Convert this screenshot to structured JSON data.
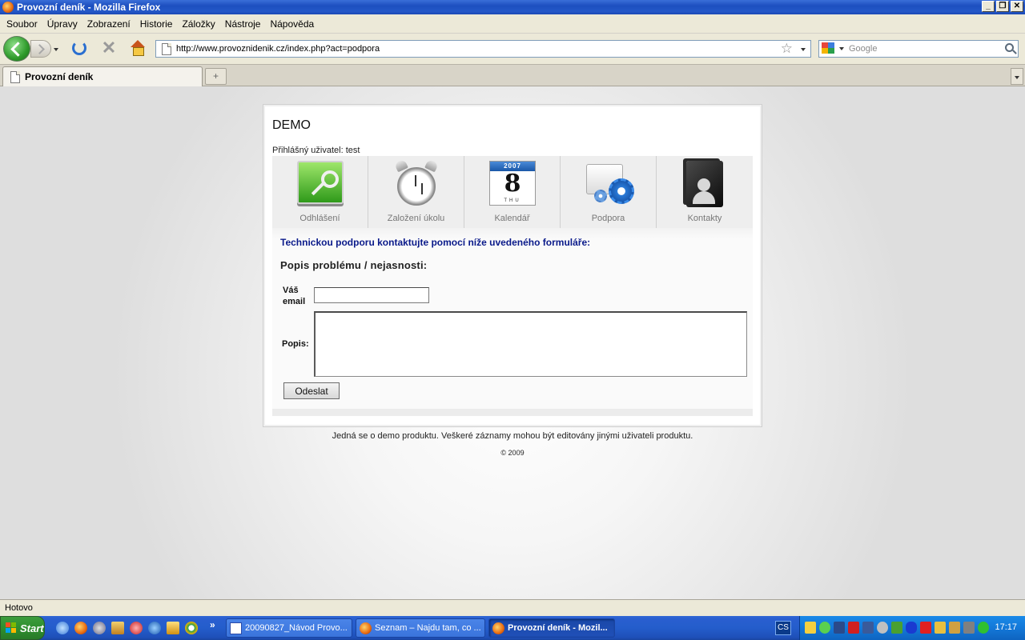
{
  "window": {
    "title": "Provozní deník - Mozilla Firefox",
    "buttons": {
      "minimize": "_",
      "maximize": "❐",
      "close": "✕"
    }
  },
  "menu": [
    "Soubor",
    "Úpravy",
    "Zobrazení",
    "Historie",
    "Záložky",
    "Nástroje",
    "Nápověda"
  ],
  "toolbar": {
    "url": "http://www.provoznidenik.cz/index.php?act=podpora",
    "search_placeholder": "Google"
  },
  "tabs": [
    {
      "label": "Provozní deník"
    }
  ],
  "page": {
    "site_title": "DEMO",
    "logged_user": "Přihlášný uživatel: test",
    "nav": [
      {
        "label": "Odhlášení",
        "icon": "key-icon"
      },
      {
        "label": "Založení úkolu",
        "icon": "alarm-clock-icon"
      },
      {
        "label": "Kalendář",
        "icon": "calendar-icon",
        "day": "8",
        "weekday": "THU",
        "year": "2007"
      },
      {
        "label": "Podpora",
        "icon": "support-gears-icon"
      },
      {
        "label": "Kontakty",
        "icon": "contacts-folder-icon"
      }
    ],
    "support_intro": "Technickou podporu kontaktujte pomocí níže uvedeného formuláře:",
    "form_title": "Popis problému / nejasnosti:",
    "email_label": "Váš email",
    "email_value": "",
    "popis_label": "Popis:",
    "popis_value": "",
    "submit_label": "Odeslat",
    "footer_note": "Jedná se o demo produktu. Veškeré záznamy mohou být editovány jinými uživateli produktu.",
    "copyright": "© 2009"
  },
  "status": "Hotovo",
  "taskbar": {
    "start_label": "Start",
    "more": "»",
    "tasks": [
      {
        "label": "20090827_Návod Provo...",
        "active": false
      },
      {
        "label": "Seznam – Najdu tam, co ...",
        "active": false
      },
      {
        "label": "Provozní deník - Mozil...",
        "active": true
      }
    ],
    "language": "CS",
    "clock": "17:17"
  },
  "colors": {
    "titlebar": "#1d4fbf",
    "intro_text": "#0a1a8a",
    "taskbar": "#245dcb",
    "start": "#2f8f2f"
  }
}
